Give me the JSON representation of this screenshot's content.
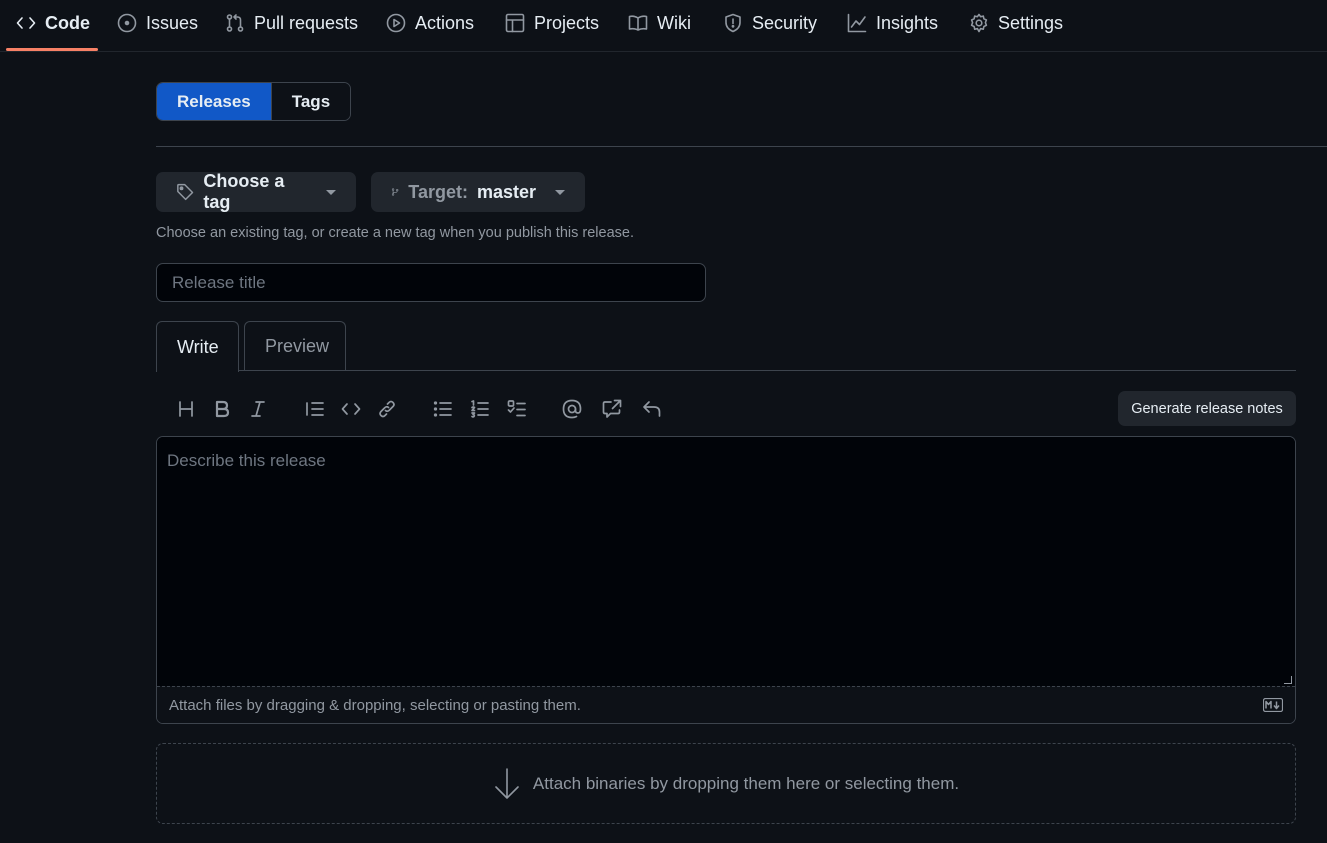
{
  "repo_nav": {
    "items": [
      {
        "label": "Code",
        "icon": "code-icon",
        "selected": true
      },
      {
        "label": "Issues",
        "icon": "issue-opened-icon"
      },
      {
        "label": "Pull requests",
        "icon": "git-pull-request-icon"
      },
      {
        "label": "Actions",
        "icon": "play-icon"
      },
      {
        "label": "Projects",
        "icon": "table-icon"
      },
      {
        "label": "Wiki",
        "icon": "book-icon"
      },
      {
        "label": "Security",
        "icon": "shield-icon"
      },
      {
        "label": "Insights",
        "icon": "graph-icon"
      },
      {
        "label": "Settings",
        "icon": "gear-icon"
      }
    ]
  },
  "segmented": {
    "releases": "Releases",
    "tags": "Tags"
  },
  "tag_picker": {
    "label": "Choose a tag",
    "icon": "tag-icon"
  },
  "target_picker": {
    "prefix": "Target:",
    "branch": "master",
    "icon": "git-branch-icon"
  },
  "tag_hint": "Choose an existing tag, or create a new tag when you publish this release.",
  "release_title": {
    "placeholder": "Release title",
    "value": ""
  },
  "editor_tabs": {
    "write": "Write",
    "preview": "Preview"
  },
  "toolbar": {
    "tools": [
      "heading-icon",
      "bold-icon",
      "italic-icon",
      "quote-icon",
      "code-icon",
      "link-icon",
      "unordered-list-icon",
      "ordered-list-icon",
      "tasklist-icon",
      "mention-icon",
      "cross-reference-icon",
      "reply-icon"
    ],
    "generate_notes": "Generate release notes"
  },
  "body": {
    "placeholder": "Describe this release",
    "value": ""
  },
  "attach_files": "Attach files by dragging & dropping, selecting or pasting them.",
  "binaries": "Attach binaries by dropping them here or selecting them.",
  "colors": {
    "background": "#0d1117",
    "accent": "#1158c7",
    "nav_underline": "#f78166",
    "border": "#3d444d"
  }
}
